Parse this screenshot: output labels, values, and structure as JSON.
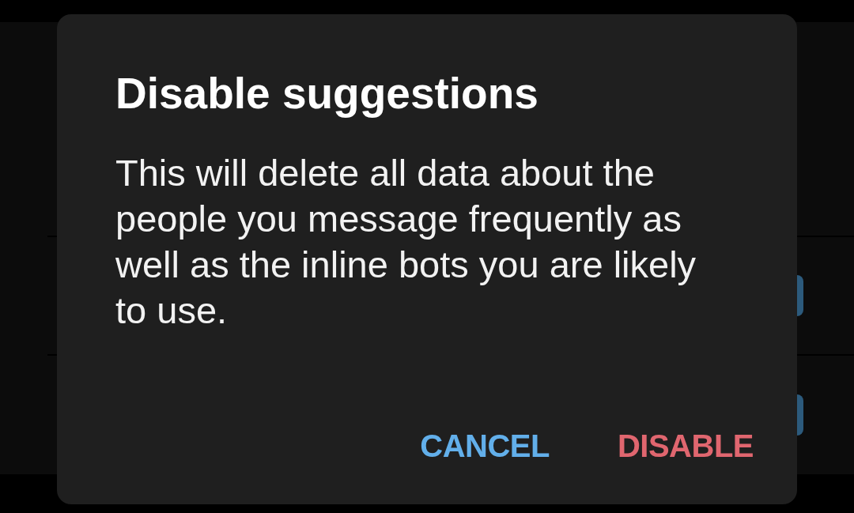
{
  "settings_list": {
    "rows": [
      {
        "on": true
      },
      {
        "on": true
      }
    ]
  },
  "dialog": {
    "title": "Disable suggestions",
    "message": "This will delete all data about the people you message frequently as well as the inline bots you are likely to use.",
    "buttons": [
      {
        "label": "CANCEL",
        "kind": "neutral"
      },
      {
        "label": "DISABLE",
        "kind": "destructive"
      }
    ]
  }
}
